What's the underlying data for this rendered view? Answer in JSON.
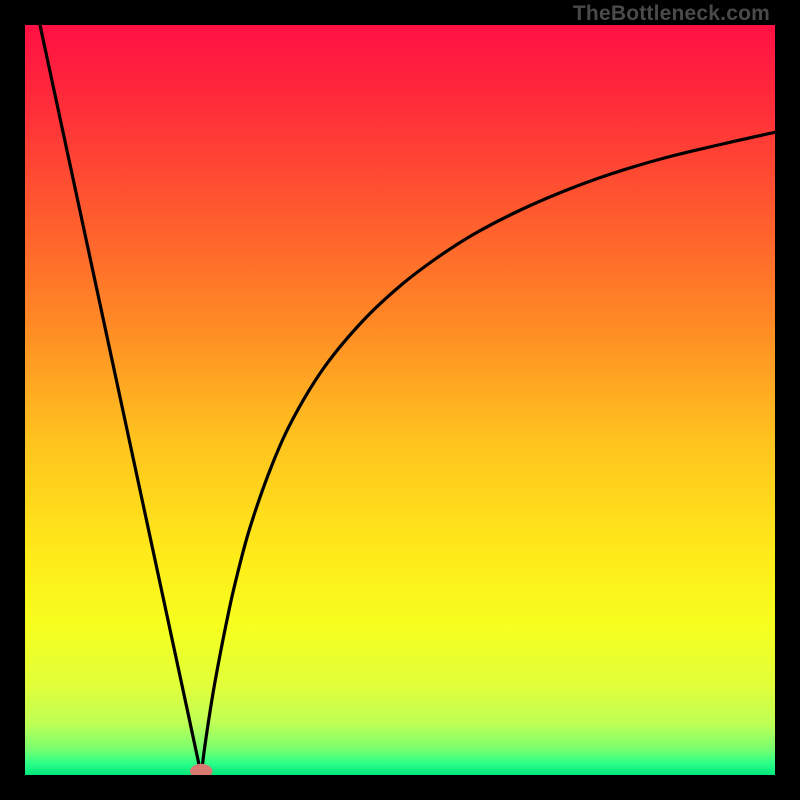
{
  "watermark": "TheBottleneck.com",
  "chart_data": {
    "type": "line",
    "title": "",
    "xlabel": "",
    "ylabel": "",
    "xlim": [
      0,
      100
    ],
    "ylim": [
      0,
      100
    ],
    "gradient_stops": [
      {
        "offset": 0.0,
        "color": "#ff1044"
      },
      {
        "offset": 0.1,
        "color": "#ff2b3a"
      },
      {
        "offset": 0.25,
        "color": "#ff5a2e"
      },
      {
        "offset": 0.4,
        "color": "#ff8a25"
      },
      {
        "offset": 0.55,
        "color": "#ffc21e"
      },
      {
        "offset": 0.7,
        "color": "#ffe91a"
      },
      {
        "offset": 0.8,
        "color": "#f6ff1e"
      },
      {
        "offset": 0.88,
        "color": "#e1ff3a"
      },
      {
        "offset": 0.93,
        "color": "#c0ff55"
      },
      {
        "offset": 0.965,
        "color": "#7aff6e"
      },
      {
        "offset": 0.985,
        "color": "#2aff88"
      },
      {
        "offset": 1.0,
        "color": "#00e57a"
      }
    ],
    "series": [
      {
        "name": "left-branch",
        "x": [
          2,
          4,
          6,
          8,
          10,
          12,
          14,
          16,
          18,
          20,
          22,
          23.5
        ],
        "y": [
          100,
          90.7,
          81.4,
          72.1,
          62.8,
          53.5,
          44.2,
          34.9,
          25.6,
          16.3,
          7.0,
          0.0
        ]
      },
      {
        "name": "right-branch",
        "x": [
          23.5,
          24,
          25,
          26,
          27,
          28,
          30,
          33,
          36,
          40,
          45,
          50,
          55,
          60,
          66,
          72,
          78,
          85,
          92,
          100
        ],
        "y": [
          0.0,
          4.0,
          10.5,
          16.0,
          21.0,
          25.5,
          33.0,
          41.5,
          48.0,
          54.5,
          60.5,
          65.2,
          69.0,
          72.2,
          75.3,
          77.9,
          80.1,
          82.2,
          83.9,
          85.7
        ]
      }
    ],
    "marker": {
      "x": 23.5,
      "y": 0.5,
      "color": "#d77a72",
      "rx": 1.5,
      "ry": 1.0
    }
  }
}
